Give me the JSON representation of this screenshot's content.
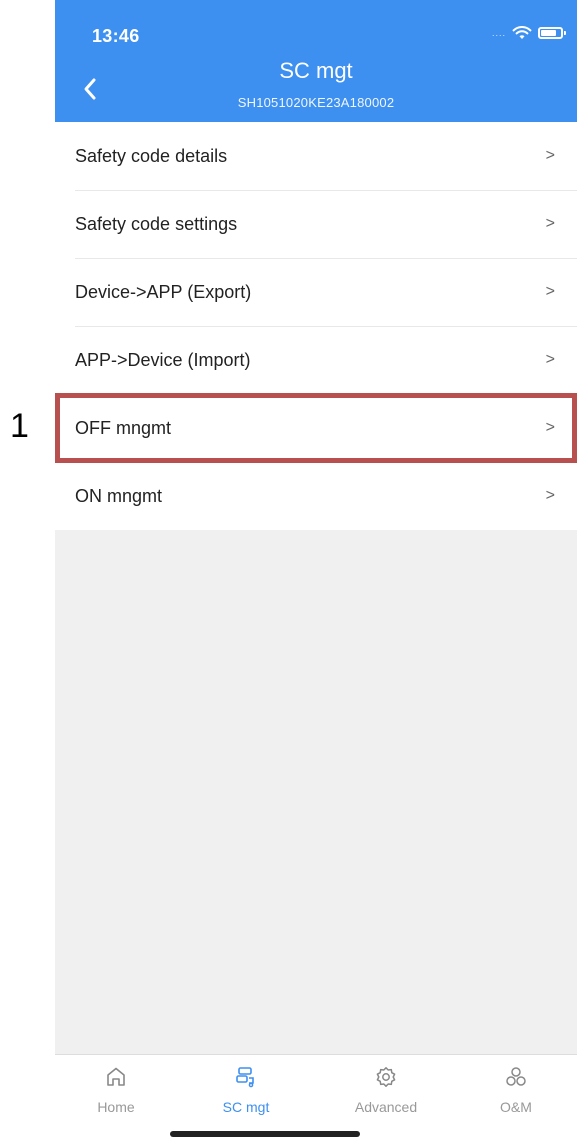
{
  "status_bar": {
    "time": "13:46",
    "signal": "....",
    "wifi_icon": "wifi-icon",
    "battery_icon": "battery-icon"
  },
  "header": {
    "title": "SC mgt",
    "subtitle": "SH1051020KE23A180002",
    "back_icon": "chevron-left-icon"
  },
  "menu": {
    "items": [
      {
        "label": "Safety code details",
        "chevron": ">"
      },
      {
        "label": "Safety code settings",
        "chevron": ">"
      },
      {
        "label": "Device->APP (Export)",
        "chevron": ">"
      },
      {
        "label": "APP->Device (Import)",
        "chevron": ">"
      },
      {
        "label": "OFF mngmt",
        "chevron": ">"
      },
      {
        "label": "ON mngmt",
        "chevron": ">"
      }
    ]
  },
  "annotation": {
    "label": "1",
    "color": "#b85050"
  },
  "tabbar": {
    "active": "SC mgt",
    "tabs": [
      {
        "label": "Home",
        "icon": "home-icon"
      },
      {
        "label": "SC mgt",
        "icon": "sc-mgt-icon"
      },
      {
        "label": "Advanced",
        "icon": "gear-icon"
      },
      {
        "label": "O&M",
        "icon": "om-icon"
      }
    ]
  },
  "colors": {
    "accent": "#3d8ff0",
    "background": "#f0f0f0",
    "inactive_tab": "#999999"
  }
}
